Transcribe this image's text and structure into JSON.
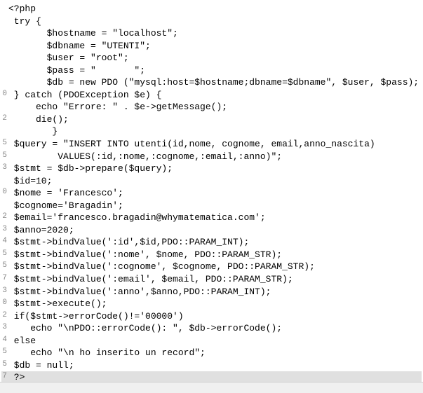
{
  "code": {
    "lines": [
      {
        "g": "",
        "text": "<?php"
      },
      {
        "g": "",
        "text": ""
      },
      {
        "g": "",
        "text": " try {"
      },
      {
        "g": "",
        "text": "       $hostname = \"localhost\";"
      },
      {
        "g": "",
        "text": "       $dbname = \"UTENTI\";"
      },
      {
        "g": "",
        "text": "       $user = \"root\";"
      },
      {
        "g": "",
        "text": "       $pass = \"       \";"
      },
      {
        "g": "",
        "text": "       $db = new PDO (\"mysql:host=$hostname;dbname=$dbname\", $user, $pass);"
      },
      {
        "g": "",
        "text": ""
      },
      {
        "g": "0",
        "text": " } catch (PDOException $e) {"
      },
      {
        "g": "",
        "text": "     echo \"Errore: \" . $e->getMessage();"
      },
      {
        "g": "2",
        "text": "     die();"
      },
      {
        "g": "",
        "text": "        }"
      },
      {
        "g": "",
        "text": ""
      },
      {
        "g": "5",
        "text": " $query = \"INSERT INTO utenti(id,nome, cognome, email,anno_nascita)"
      },
      {
        "g": "5",
        "text": "         VALUES(:id,:nome,:cognome,:email,:anno)\";"
      },
      {
        "g": "",
        "text": ""
      },
      {
        "g": "3",
        "text": " $stmt = $db->prepare($query);"
      },
      {
        "g": "",
        "text": " $id=10;"
      },
      {
        "g": "0",
        "text": " $nome = 'Francesco';"
      },
      {
        "g": "",
        "text": " $cognome='Bragadin';"
      },
      {
        "g": "2",
        "text": " $email='francesco.bragadin@whymatematica.com';"
      },
      {
        "g": "3",
        "text": " $anno=2020;"
      },
      {
        "g": "4",
        "text": " $stmt->bindValue(':id',$id,PDO::PARAM_INT);"
      },
      {
        "g": "5",
        "text": " $stmt->bindValue(':nome', $nome, PDO::PARAM_STR);"
      },
      {
        "g": "5",
        "text": " $stmt->bindValue(':cognome', $cognome, PDO::PARAM_STR);"
      },
      {
        "g": "7",
        "text": " $stmt->bindValue(':email', $email, PDO::PARAM_STR);"
      },
      {
        "g": "3",
        "text": " $stmt->bindValue(':anno',$anno,PDO::PARAM_INT);"
      },
      {
        "g": "",
        "text": ""
      },
      {
        "g": "0",
        "text": " $stmt->execute();"
      },
      {
        "g": "",
        "text": ""
      },
      {
        "g": "2",
        "text": " if($stmt->errorCode()!='00000')"
      },
      {
        "g": "3",
        "text": "    echo \"\\nPDO::errorCode(): \", $db->errorCode();"
      },
      {
        "g": "4",
        "text": " else"
      },
      {
        "g": "5",
        "text": "    echo \"\\n ho inserito un record\";"
      },
      {
        "g": "5",
        "text": " $db = null;"
      },
      {
        "g": "7",
        "text": " ?>",
        "highlight": true
      }
    ]
  }
}
